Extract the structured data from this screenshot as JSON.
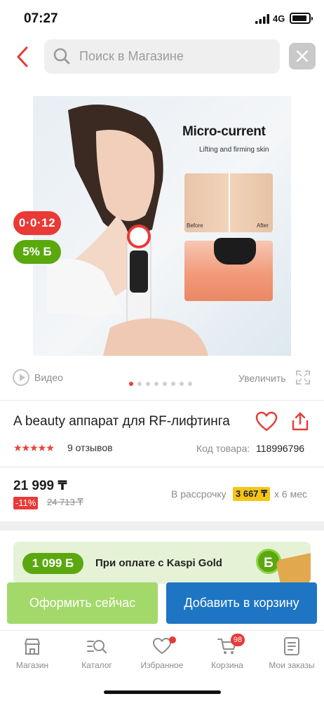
{
  "status_bar": {
    "time": "07:27",
    "network": "4G"
  },
  "search": {
    "placeholder": "Поиск в Магазине"
  },
  "product_image": {
    "title": "Micro-current",
    "subtitle": "Lifting and firming skin",
    "before_label": "Before",
    "after_label": "After"
  },
  "badges": {
    "timer": "0·0·12",
    "bonus": "5% Б"
  },
  "media": {
    "video_label": "Видео",
    "zoom_label": "Увеличить",
    "slides_total": 8,
    "slide_active": 1
  },
  "product": {
    "title": "A beauty аппарат для RF-лифтинга",
    "rating": 4.5,
    "stars": "★★★★★",
    "reviews": "9 отзывов",
    "code_label": "Код товара:",
    "code_value": "118996796"
  },
  "price": {
    "current": "21 999 ₸",
    "discount": "-11%",
    "old": "24 713 ₸",
    "installment_label": "В рассрочку",
    "installment_amount": "3 667 ₸",
    "installment_term": "х 6 мес"
  },
  "kaspi_banner": {
    "bonus": "1 099 Б",
    "text": "При оплате с Kaspi Gold",
    "coin": "Б"
  },
  "actions": {
    "checkout": "Оформить сейчас",
    "add_to_cart": "Добавить в корзину"
  },
  "bottom_nav": {
    "items": [
      {
        "label": "Магазин",
        "icon": "shop-icon"
      },
      {
        "label": "Каталог",
        "icon": "catalog-icon"
      },
      {
        "label": "Избранное",
        "icon": "heart-icon"
      },
      {
        "label": "Корзина",
        "icon": "cart-icon"
      },
      {
        "label": "Мои заказы",
        "icon": "orders-icon"
      }
    ],
    "cart_count": "98"
  },
  "colors": {
    "accent_red": "#e93a36",
    "kaspi_green": "#5aa80e",
    "cart_blue": "#1d75c4",
    "checkout_green": "#a3d96a",
    "installment_yellow": "#f5c518"
  }
}
